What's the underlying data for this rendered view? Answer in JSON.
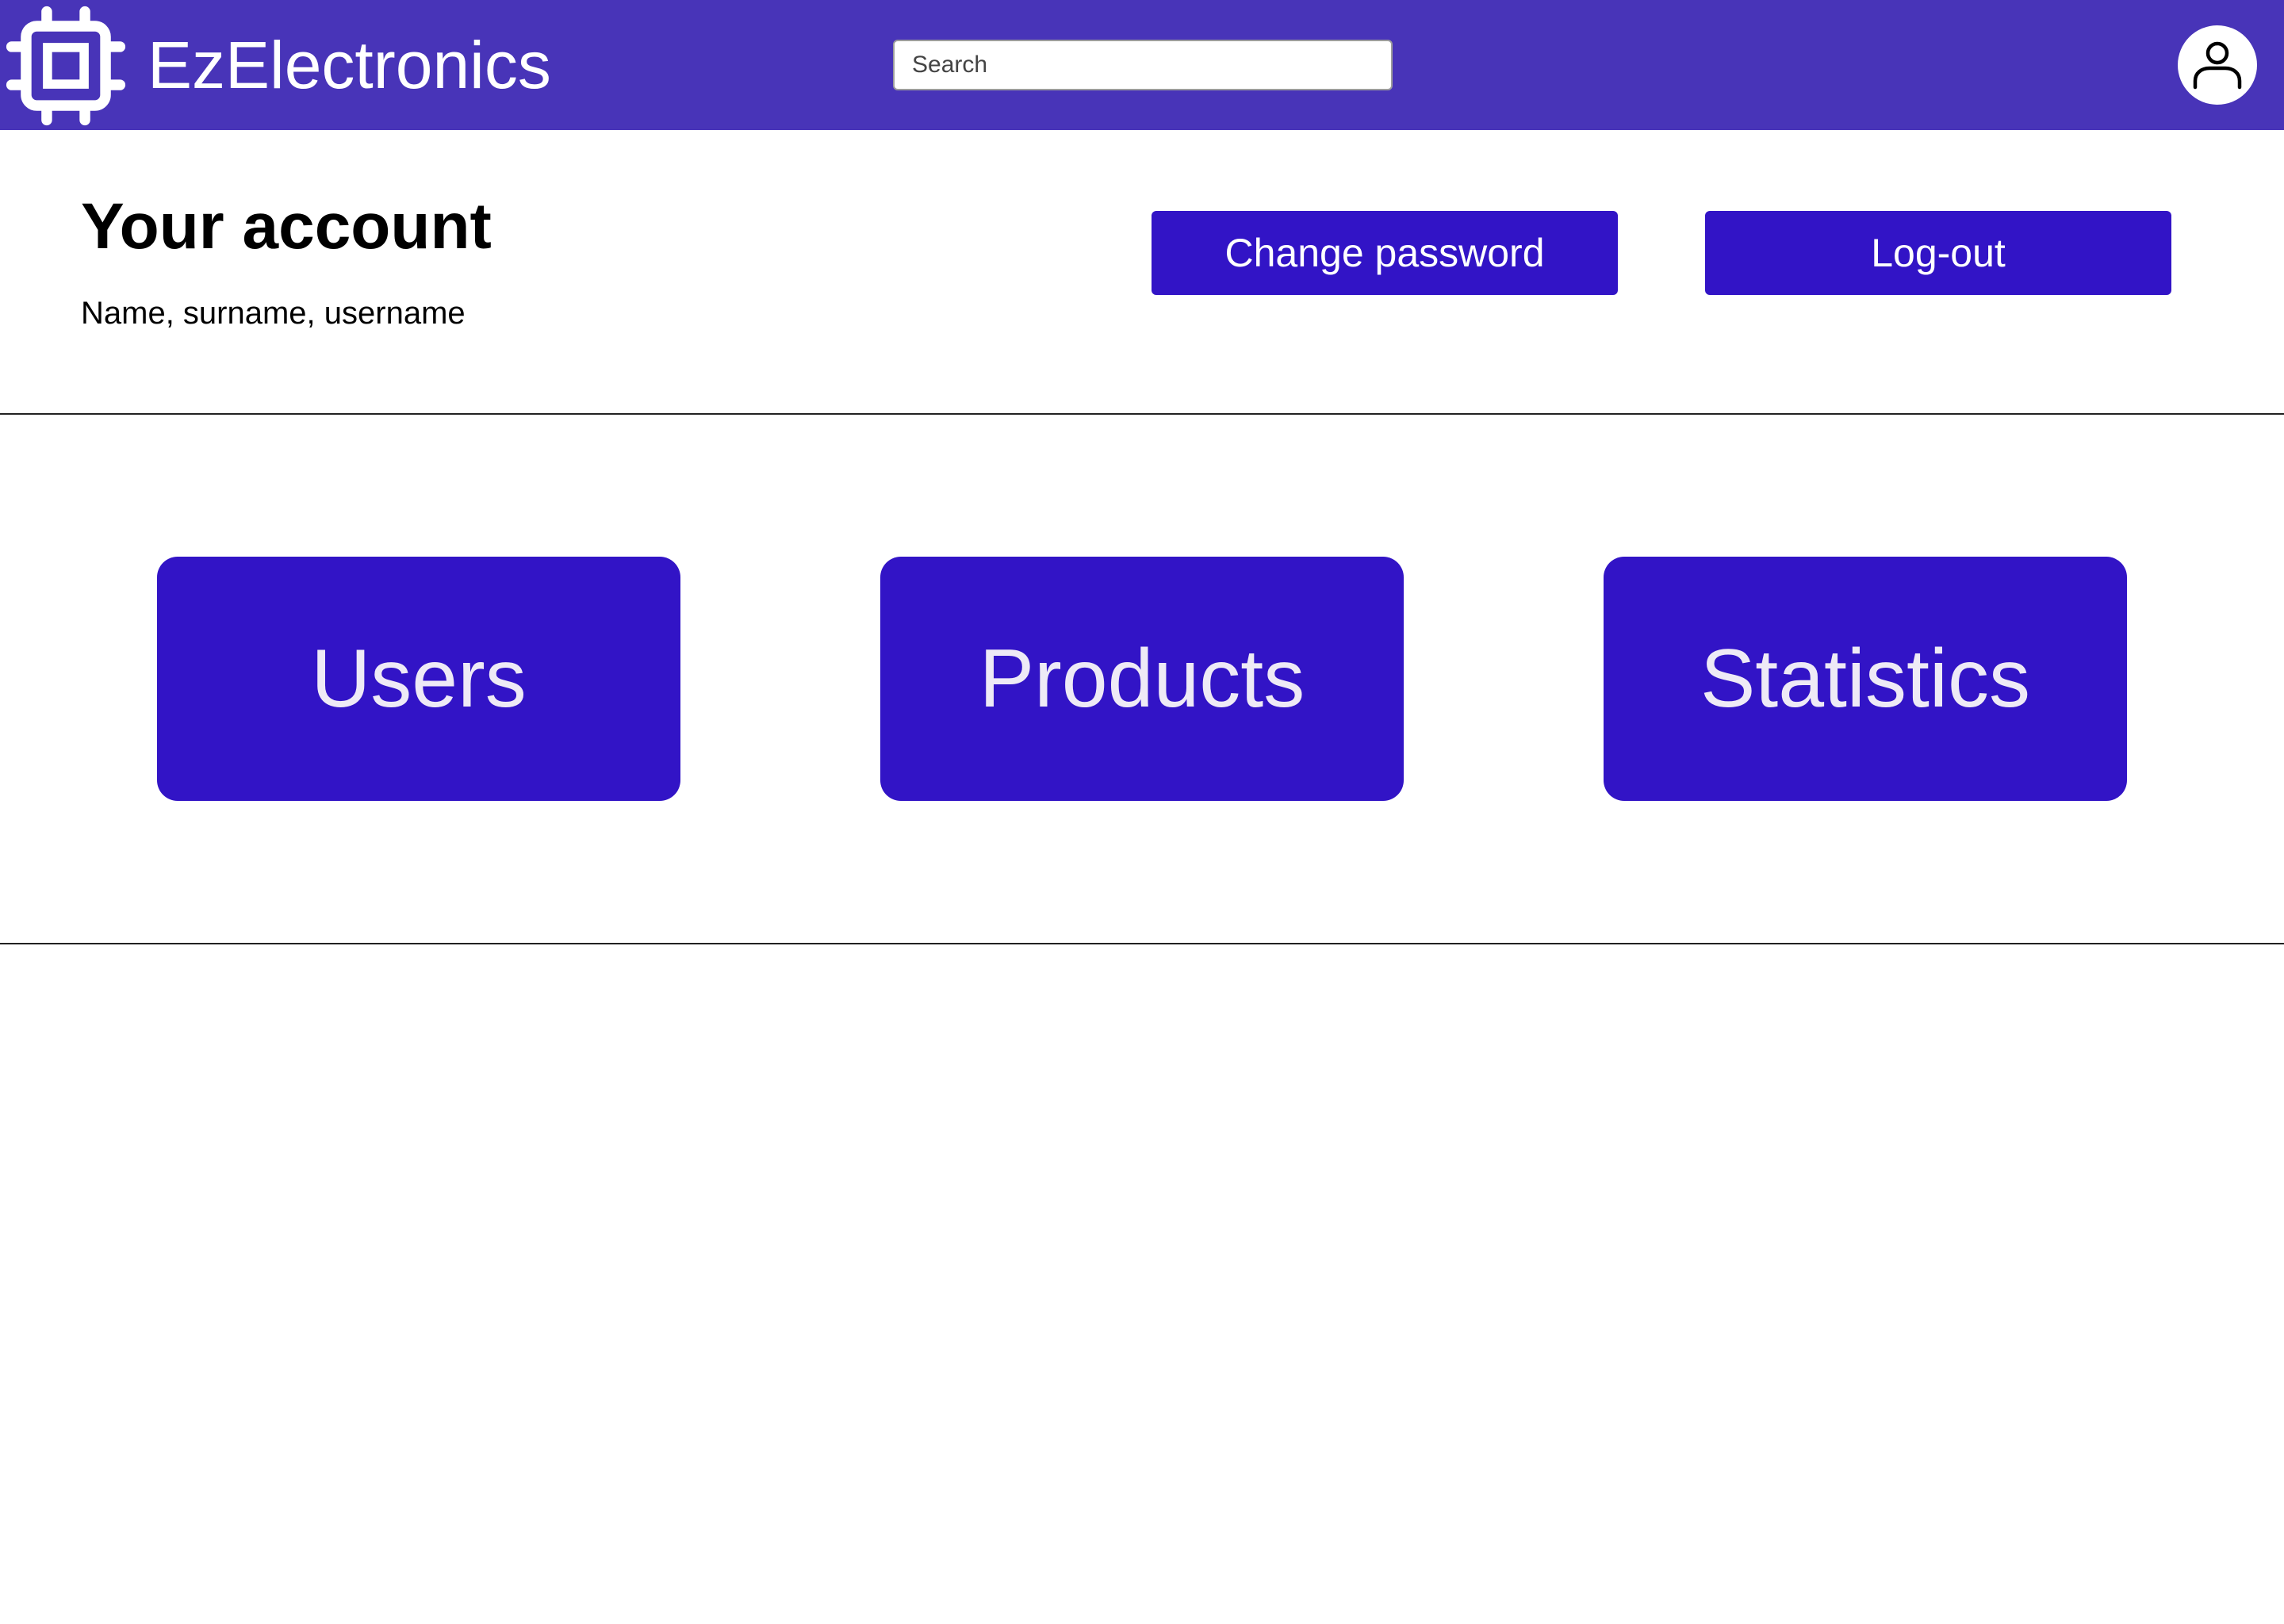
{
  "header": {
    "brand": "EzElectronics",
    "logo_icon": "cpu-chip-icon",
    "search_placeholder": "Search",
    "avatar_icon": "user-icon",
    "background_color": "#4834b8"
  },
  "account": {
    "title": "Your account",
    "subtitle": "Name, surname, username",
    "change_password_label": "Change password",
    "logout_label": "Log-out"
  },
  "tiles": [
    {
      "label": "Users"
    },
    {
      "label": "Products"
    },
    {
      "label": "Statistics"
    }
  ],
  "colors": {
    "accent": "#3214c6",
    "tile_text": "#eeeaf6"
  }
}
